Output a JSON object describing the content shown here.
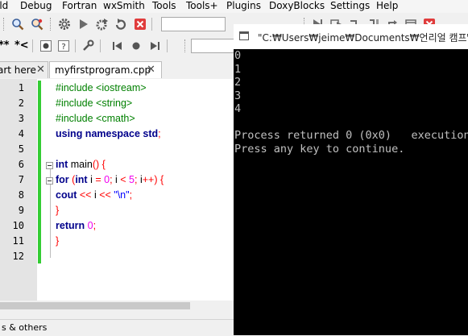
{
  "menubar": {
    "items": [
      "ild",
      "Debug",
      "Fortran",
      "wxSmith",
      "Tools",
      "Tools+",
      "Plugins",
      "DoxyBlocks",
      "Settings",
      "Help"
    ]
  },
  "toolbar2": {
    "symbols": [
      "**",
      "*<"
    ]
  },
  "tabs": {
    "first": "art here",
    "active": "myfirstprogram.cpp",
    "close_glyph": "✕"
  },
  "editor": {
    "line_numbers": [
      "1",
      "2",
      "3",
      "4",
      "5",
      "6",
      "7",
      "8",
      "9",
      "10",
      "11",
      "12"
    ],
    "lines": [
      [
        {
          "t": "#include <iostream>",
          "c": "pp"
        }
      ],
      [
        {
          "t": "#include <string>",
          "c": "pp"
        }
      ],
      [
        {
          "t": "#include <cmath>",
          "c": "pp"
        }
      ],
      [
        {
          "t": "using namespace ",
          "c": "kw"
        },
        {
          "t": "std",
          "c": "kw"
        },
        {
          "t": ";",
          "c": "op"
        }
      ],
      [],
      [
        {
          "t": "int",
          "c": "kw"
        },
        {
          "t": " main",
          "c": "id"
        },
        {
          "t": "() {",
          "c": "op"
        }
      ],
      [
        {
          "t": "for",
          "c": "kw"
        },
        {
          "t": " (",
          "c": "op"
        },
        {
          "t": "int",
          "c": "kw"
        },
        {
          "t": " i ",
          "c": "id"
        },
        {
          "t": "= ",
          "c": "op"
        },
        {
          "t": "0",
          "c": "num"
        },
        {
          "t": "; ",
          "c": "op"
        },
        {
          "t": "i ",
          "c": "id"
        },
        {
          "t": "< ",
          "c": "op"
        },
        {
          "t": "5",
          "c": "num"
        },
        {
          "t": "; ",
          "c": "op"
        },
        {
          "t": "i",
          "c": "id"
        },
        {
          "t": "++) {",
          "c": "op"
        }
      ],
      [
        {
          "t": "cout",
          "c": "kw"
        },
        {
          "t": " << ",
          "c": "op"
        },
        {
          "t": "i",
          "c": "id"
        },
        {
          "t": " << ",
          "c": "op"
        },
        {
          "t": "\"\\n\"",
          "c": "str"
        },
        {
          "t": ";",
          "c": "op"
        }
      ],
      [
        {
          "t": "}",
          "c": "op"
        }
      ],
      [
        {
          "t": "return",
          "c": "kw"
        },
        {
          "t": " ",
          "c": "id"
        },
        {
          "t": "0",
          "c": "num"
        },
        {
          "t": ";",
          "c": "op"
        }
      ],
      [
        {
          "t": "}",
          "c": "op"
        }
      ],
      []
    ]
  },
  "statusbar": {
    "text": "s & others"
  },
  "console": {
    "title": "\"C:₩Users₩jeime₩Documents₩언리얼 캠프₩C+",
    "output_lines": [
      "0",
      "1",
      "2",
      "3",
      "4",
      "",
      "Process returned 0 (0x0)   execution",
      "Press any key to continue."
    ]
  },
  "icons": [
    "search-icon",
    "find-replace-icon",
    "settings-gear-icon",
    "run-icon",
    "build-gear-icon",
    "rebuild-icon",
    "abort-icon",
    "debug-run-icon",
    "run-to-cursor-icon",
    "next-line-icon",
    "step-into-icon",
    "step-out-icon",
    "stop-debugger-icon",
    "toggle-comment-icon",
    "help-icon",
    "wrench-icon",
    "jump-back-icon",
    "record-icon",
    "jump-forward-icon"
  ],
  "colors": {
    "keyword": "#00008b",
    "preprocessor": "#008000",
    "number": "#f000f0",
    "string": "#0000ff",
    "operator": "#ff0000",
    "change_bar": "#33cc33"
  }
}
